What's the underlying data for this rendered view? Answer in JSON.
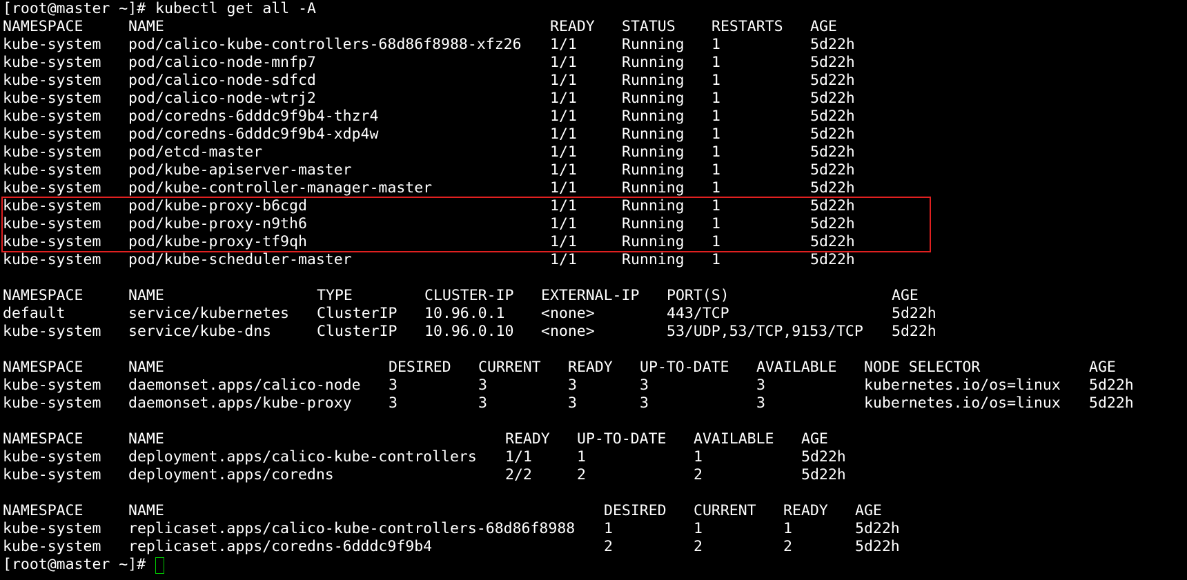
{
  "accent_colors": {
    "background": "#000000",
    "text": "#ffffff",
    "highlight_box": "#e02020",
    "cursor": "#00cc00"
  },
  "command_line": {
    "prompt": "[root@master ~]#",
    "command": "kubectl get all -A"
  },
  "pods": {
    "headers": [
      "NAMESPACE",
      "NAME",
      "READY",
      "STATUS",
      "RESTARTS",
      "AGE"
    ],
    "rows": [
      [
        "kube-system",
        "pod/calico-kube-controllers-68d86f8988-xfz26",
        "1/1",
        "Running",
        "1",
        "5d22h"
      ],
      [
        "kube-system",
        "pod/calico-node-mnfp7",
        "1/1",
        "Running",
        "1",
        "5d22h"
      ],
      [
        "kube-system",
        "pod/calico-node-sdfcd",
        "1/1",
        "Running",
        "1",
        "5d22h"
      ],
      [
        "kube-system",
        "pod/calico-node-wtrj2",
        "1/1",
        "Running",
        "1",
        "5d22h"
      ],
      [
        "kube-system",
        "pod/coredns-6dddc9f9b4-thzr4",
        "1/1",
        "Running",
        "1",
        "5d22h"
      ],
      [
        "kube-system",
        "pod/coredns-6dddc9f9b4-xdp4w",
        "1/1",
        "Running",
        "1",
        "5d22h"
      ],
      [
        "kube-system",
        "pod/etcd-master",
        "1/1",
        "Running",
        "1",
        "5d22h"
      ],
      [
        "kube-system",
        "pod/kube-apiserver-master",
        "1/1",
        "Running",
        "1",
        "5d22h"
      ],
      [
        "kube-system",
        "pod/kube-controller-manager-master",
        "1/1",
        "Running",
        "1",
        "5d22h"
      ],
      [
        "kube-system",
        "pod/kube-proxy-b6cgd",
        "1/1",
        "Running",
        "1",
        "5d22h"
      ],
      [
        "kube-system",
        "pod/kube-proxy-n9th6",
        "1/1",
        "Running",
        "1",
        "5d22h"
      ],
      [
        "kube-system",
        "pod/kube-proxy-tf9qh",
        "1/1",
        "Running",
        "1",
        "5d22h"
      ],
      [
        "kube-system",
        "pod/kube-scheduler-master",
        "1/1",
        "Running",
        "1",
        "5d22h"
      ]
    ]
  },
  "services": {
    "headers": [
      "NAMESPACE",
      "NAME",
      "TYPE",
      "CLUSTER-IP",
      "EXTERNAL-IP",
      "PORT(S)",
      "AGE"
    ],
    "rows": [
      [
        "default",
        "service/kubernetes",
        "ClusterIP",
        "10.96.0.1",
        "<none>",
        "443/TCP",
        "5d22h"
      ],
      [
        "kube-system",
        "service/kube-dns",
        "ClusterIP",
        "10.96.0.10",
        "<none>",
        "53/UDP,53/TCP,9153/TCP",
        "5d22h"
      ]
    ]
  },
  "daemonsets": {
    "headers": [
      "NAMESPACE",
      "NAME",
      "DESIRED",
      "CURRENT",
      "READY",
      "UP-TO-DATE",
      "AVAILABLE",
      "NODE SELECTOR",
      "AGE"
    ],
    "rows": [
      [
        "kube-system",
        "daemonset.apps/calico-node",
        "3",
        "3",
        "3",
        "3",
        "3",
        "kubernetes.io/os=linux",
        "5d22h"
      ],
      [
        "kube-system",
        "daemonset.apps/kube-proxy",
        "3",
        "3",
        "3",
        "3",
        "3",
        "kubernetes.io/os=linux",
        "5d22h"
      ]
    ]
  },
  "deployments": {
    "headers": [
      "NAMESPACE",
      "NAME",
      "READY",
      "UP-TO-DATE",
      "AVAILABLE",
      "AGE"
    ],
    "rows": [
      [
        "kube-system",
        "deployment.apps/calico-kube-controllers",
        "1/1",
        "1",
        "1",
        "5d22h"
      ],
      [
        "kube-system",
        "deployment.apps/coredns",
        "2/2",
        "2",
        "2",
        "5d22h"
      ]
    ]
  },
  "replicasets": {
    "headers": [
      "NAMESPACE",
      "NAME",
      "DESIRED",
      "CURRENT",
      "READY",
      "AGE"
    ],
    "rows": [
      [
        "kube-system",
        "replicaset.apps/calico-kube-controllers-68d86f8988",
        "1",
        "1",
        "1",
        "5d22h"
      ],
      [
        "kube-system",
        "replicaset.apps/coredns-6dddc9f9b4",
        "2",
        "2",
        "2",
        "5d22h"
      ]
    ]
  },
  "final_prompt": "[root@master ~]#"
}
